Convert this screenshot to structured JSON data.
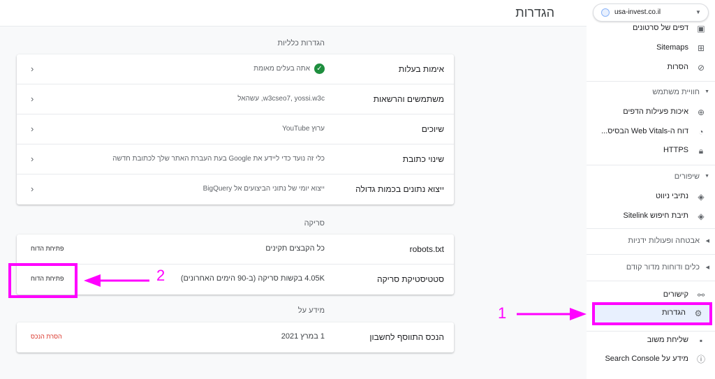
{
  "page_title": "הגדרות",
  "general": {
    "title": "הגדרות כלליות",
    "rows": [
      {
        "label": "אימות בעלות",
        "value": "אתה בעלים מאומת",
        "icon": "check-circle-icon"
      },
      {
        "label": "משתמשים והרשאות",
        "value": "w3cseo7, yossi.w3c, עשהאל"
      },
      {
        "label": "שיוכים",
        "value": "ערוץ YouTube"
      },
      {
        "label": "שינוי כתובת",
        "value": "כלי זה נועד כדי ליידע את Google בעת העברת האתר שלך לכתובת חדשה"
      },
      {
        "label": "ייצוא נתונים בכמות גדולה",
        "value": "ייצוא יומי של נתוני הביצועים אל BigQuery"
      }
    ]
  },
  "crawl": {
    "title": "סריקה",
    "rows": [
      {
        "label": "robots.txt",
        "value": "כל הקבצים תקינים",
        "link": "פתיחת הדוח"
      },
      {
        "label": "סטטיסטיקת סריקה",
        "value": "4.05K בקשות סריקה (ב-90 הימים האחרונים)",
        "link": "פתיחת הדוח"
      }
    ]
  },
  "about": {
    "title": "מידע על",
    "rows": [
      {
        "label": "הנכס התווסף לחשבון",
        "value": "1 במרץ 2021",
        "link": "הסרת הנכס"
      }
    ]
  },
  "annotations": {
    "one": "1",
    "two": "2",
    "color": "#ff00ff"
  },
  "sidebar": {
    "property": "usa-invest.co.il",
    "items": [
      {
        "label": "דפים של סרטונים",
        "icon": "video-page-icon"
      },
      {
        "label": "Sitemaps",
        "icon": "sitemap-icon"
      },
      {
        "label": "הסרות",
        "icon": "eye-off-icon"
      },
      {
        "group": "חוויית משתמש"
      },
      {
        "label": "איכות פעילות הדפים",
        "icon": "plus-circle-icon"
      },
      {
        "label": "דוח ה-Web Vitals הבסיס...",
        "icon": "speed-gauge-icon"
      },
      {
        "label": "HTTPS",
        "icon": "lock-icon"
      },
      {
        "group": "שיפורים"
      },
      {
        "label": "נתיבי ניווט",
        "icon": "layers-icon"
      },
      {
        "label": "תיבת חיפוש Sitelink",
        "icon": "layers-icon"
      },
      {
        "group": "אבטחה ופעולות ידניות"
      },
      {
        "group": "כלים ודוחות מדור קודם"
      },
      {
        "label": "קישורים",
        "icon": "links-icon"
      },
      {
        "label": "הגדרות",
        "icon": "gear-icon"
      },
      {
        "label": "שליחת משוב",
        "icon": "feedback-icon"
      },
      {
        "label": "מידע על Search Console",
        "icon": "info-icon"
      }
    ]
  }
}
